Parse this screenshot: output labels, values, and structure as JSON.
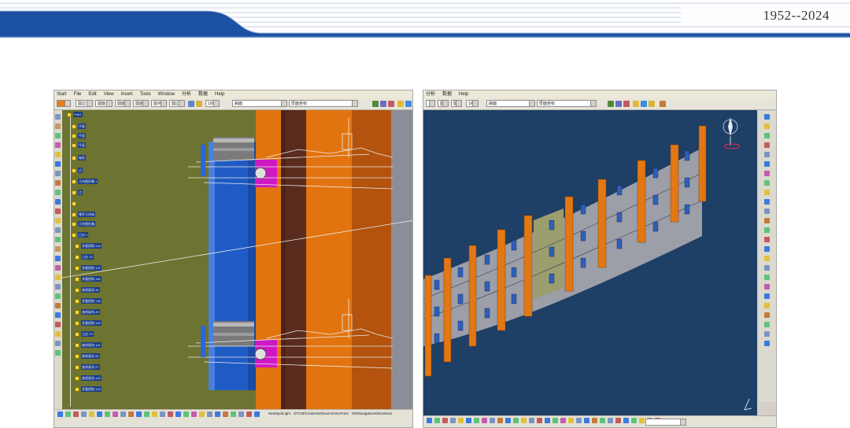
{
  "slide": {
    "title": "1952--2024",
    "colors": {
      "banner_blue": "#1c50a3",
      "banner_line": "#c6d2e4"
    }
  },
  "left_window": {
    "menu": [
      "Start",
      "File",
      "Edit",
      "View",
      "Insert",
      "Tools",
      "Window",
      "分析",
      "数据",
      "Help"
    ],
    "toolbar_combos": [
      "",
      "圆边",
      "圆面",
      "圆面",
      "圆面",
      "圆点",
      "圆边",
      "",
      "1/8",
      "曲面",
      "厚面坐标"
    ],
    "status_text": "",
    "status_right": [
      "NewSpotLight",
      "GTCM/Create/SetSourceOnCPoint",
      "GR/Navigation4DCamera"
    ],
    "tree": {
      "root": "Part1",
      "items": [
        "平面",
        "平面",
        "平面",
        "轴系",
        "点",
        "几何图形集.1",
        "点",
        "",
        "零件几何体",
        "几何图形集",
        "凸台.1",
        "多重提取.134",
        "凸台.75",
        "多重提取.137",
        "多重提取.116",
        "曲线填充.34",
        "多重提取.138",
        "曲线填充.25",
        "多重提取.140",
        "凸台.79",
        "曲线填充.141",
        "曲线填充.26",
        "曲线填充.27",
        "曲线填充.142",
        "多重提取.143"
      ]
    },
    "viewport_colors": {
      "background": "#6d7330",
      "steel_blue": "#1f5bc4",
      "orange": "#e2740f",
      "magenta": "#cf18c3"
    }
  },
  "right_window": {
    "menu": [
      "分析",
      "数据",
      "Help"
    ],
    "toolbar_combos": [
      "",
      "圆边",
      "圆面",
      "1/8",
      "曲面",
      "厚面坐标"
    ],
    "status_combo": "",
    "viewport_colors": {
      "background": "#1e3f66",
      "panel": "#9c9ea8",
      "highlight_panel": "#9b9e6e",
      "post": "#e27814",
      "bracket": "#2f5fb8"
    }
  },
  "icons": [
    "compass-icon",
    "axis-triad-icon",
    "tree-root-icon",
    "toolbar-icon"
  ]
}
